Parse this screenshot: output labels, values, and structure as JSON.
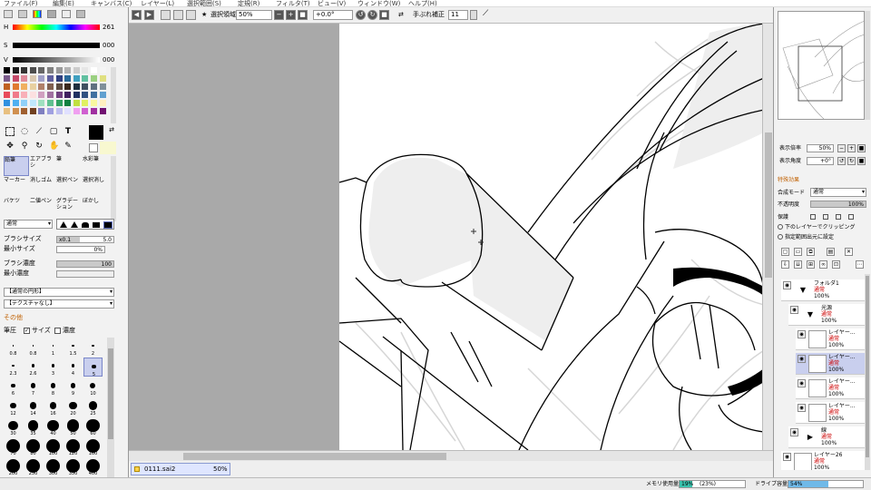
{
  "menu": {
    "items": [
      "ファイル(F)",
      "編集(E)",
      "キャンバス(C)",
      "レイヤー(L)",
      "選択範囲(S)",
      "定規(R)",
      "フィルタ(T)",
      "ビュー(V)",
      "ウィンドウ(W)",
      "ヘルプ(H)"
    ]
  },
  "color": {
    "h_label": "H",
    "h_value": "261",
    "s_label": "S",
    "s_value": "000",
    "v_label": "V",
    "v_value": "000",
    "palette": [
      "#000000",
      "#1a1a1a",
      "#333333",
      "#4d4d4d",
      "#666666",
      "#808080",
      "#999999",
      "#b3b3b3",
      "#cccccc",
      "#e6e6e6",
      "#ffffff",
      "#f5f5f5",
      "#7a5a8a",
      "#c64a6a",
      "#e08a9a",
      "#d9c8b0",
      "#a0a0c8",
      "#6060a0",
      "#304080",
      "#2a6a9a",
      "#40a0c0",
      "#60c0a0",
      "#9ad080",
      "#e0e080",
      "#c06020",
      "#e07a30",
      "#f0b060",
      "#e8d0a0",
      "#b0806a",
      "#806050",
      "#5a4a40",
      "#3a2a20",
      "#203040",
      "#405060",
      "#607080",
      "#80909a",
      "#e84a5a",
      "#f07a8a",
      "#f8b0b8",
      "#fce0e0",
      "#d0a0c0",
      "#a070a0",
      "#704080",
      "#402060",
      "#203060",
      "#305080",
      "#4070a0",
      "#60a0d0",
      "#3090e0",
      "#50b0f0",
      "#90d0f8",
      "#c0e8fc",
      "#a0e0c0",
      "#60c090",
      "#30a060",
      "#108040",
      "#c0e040",
      "#e0f060",
      "#f8f8a0",
      "#fff0c0",
      "#e8c080",
      "#d09050",
      "#a06030",
      "#704020",
      "#8080c0",
      "#a0a0e0",
      "#c0c0f0",
      "#e0e0ff",
      "#f0a0f0",
      "#d060d0",
      "#a030a0",
      "#701070"
    ]
  },
  "tools": {
    "cells": [
      {
        "label": "鉛筆",
        "selected": true
      },
      {
        "label": "エアブラシ",
        "selected": false
      },
      {
        "label": "筆",
        "selected": false
      },
      {
        "label": "水彩筆",
        "selected": false
      },
      {
        "label": "マーカー",
        "selected": false
      },
      {
        "label": "消しゴム",
        "selected": false
      },
      {
        "label": "選択ペン",
        "selected": false
      },
      {
        "label": "選択消し",
        "selected": false
      },
      {
        "label": "バケツ",
        "selected": false
      },
      {
        "label": "二値ペン",
        "selected": false
      },
      {
        "label": "グラデーション",
        "selected": false
      },
      {
        "label": "ぼかし",
        "selected": false
      }
    ]
  },
  "brush": {
    "blend_mode": "通常",
    "size_label": "ブラシサイズ",
    "size_mult": "x0.1",
    "size_value": "5.0",
    "min_size_label": "最小サイズ",
    "min_size_value": "0%",
    "density_label": "ブラシ濃度",
    "density_value": "100",
    "min_density_label": "最小濃度",
    "min_density_value": "",
    "shape_dropdown": "【通常の円形】",
    "texture_dropdown": "【テクスチャなし】",
    "other_label": "その他",
    "pressure_label": "筆圧",
    "pressure_size_label": "サイズ",
    "pressure_density_label": "濃度"
  },
  "brush_sizes": [
    "0.8",
    "0.8",
    "1",
    "1.5",
    "2",
    "2.3",
    "2.6",
    "3",
    "4",
    "5",
    "6",
    "7",
    "8",
    "9",
    "10",
    "12",
    "14",
    "16",
    "20",
    "25",
    "30",
    "35",
    "40",
    "50",
    "60",
    "70",
    "80",
    "100",
    "120",
    "160",
    "200",
    "250",
    "300",
    "350",
    "400"
  ],
  "toolbar": {
    "stabilizer_label": "選択領域",
    "zoom_value": "50%",
    "angle_value": "+0.0°",
    "stab_label": "手ぶれ補正",
    "stab_value": "11"
  },
  "canvas_tab": {
    "name": "0111.sai2",
    "zoom": "50%"
  },
  "status": {
    "memory_label": "メモリ使用量",
    "memory_value": "19%",
    "memory_extra": "(23%)",
    "drive_label": "ドライブ容量",
    "drive_value": "54%"
  },
  "navigator": {
    "zoom_label": "表示倍率",
    "zoom_value": "50%",
    "angle_label": "表示角度",
    "angle_value": "+0°"
  },
  "layer_props": {
    "header": "特殊効果",
    "blend_label": "合成モード",
    "blend_value": "通常",
    "opacity_label": "不透明度",
    "opacity_value": "100%",
    "protect_label": "保護",
    "clip_label": "下のレイヤーでクリッピング",
    "sample_label": "指定範囲出元に設定"
  },
  "layers": [
    {
      "name": "フォルダ1",
      "mode": "通常",
      "opacity": "100%",
      "type": "folder",
      "indent": 0,
      "selected": false
    },
    {
      "name": "光源",
      "mode": "通常",
      "opacity": "100%",
      "type": "folder",
      "indent": 1,
      "selected": false
    },
    {
      "name": "レイヤー...",
      "mode": "通常",
      "opacity": "100%",
      "type": "layer",
      "indent": 2,
      "selected": false
    },
    {
      "name": "レイヤー...",
      "mode": "通常",
      "opacity": "100%",
      "type": "layer",
      "indent": 2,
      "selected": true
    },
    {
      "name": "レイヤー...",
      "mode": "通常",
      "opacity": "100%",
      "type": "layer",
      "indent": 2,
      "selected": false
    },
    {
      "name": "レイヤー...",
      "mode": "通常",
      "opacity": "100%",
      "type": "layer",
      "indent": 2,
      "selected": false
    },
    {
      "name": "線",
      "mode": "通常",
      "opacity": "100%",
      "type": "folder",
      "indent": 1,
      "selected": false
    },
    {
      "name": "レイヤー26",
      "mode": "通常",
      "opacity": "100%",
      "type": "layer",
      "indent": 0,
      "selected": false
    }
  ]
}
